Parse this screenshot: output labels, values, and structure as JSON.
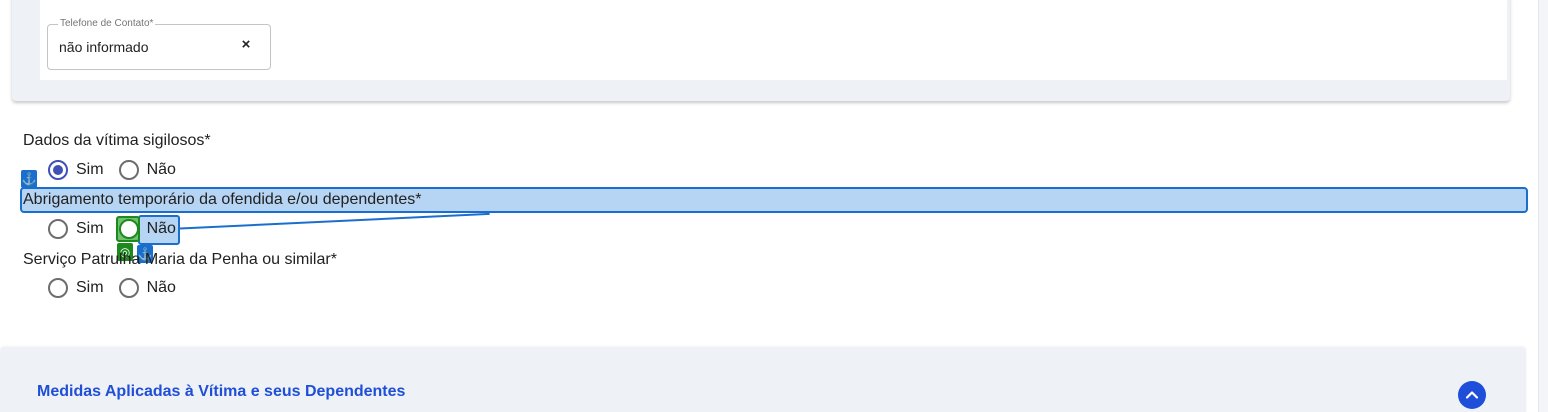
{
  "phone_field": {
    "label": "Telefone de Contato*",
    "value": "não informado",
    "clear_icon": "×"
  },
  "questions": [
    {
      "label": "Dados da vítima sigilosos*",
      "options": [
        "Sim",
        "Não"
      ],
      "selected": "Sim"
    },
    {
      "label": "Abrigamento temporário da ofendida e/ou dependentes*",
      "options": [
        "Sim",
        "Não"
      ],
      "selected": null
    },
    {
      "label": "Serviço Patrulha Maria da Penha ou similar*",
      "options": [
        "Sim",
        "Não"
      ],
      "selected": null
    }
  ],
  "accordion": {
    "title": "Medidas Aplicadas à Vítima e seus Dependentes",
    "toggle_icon": "chevron-up-icon"
  },
  "overlay": {
    "anchor_icon": "⚓",
    "target_icon": "◎"
  },
  "colors": {
    "accent": "#3f51b5",
    "link_blue": "#1f4ed8",
    "highlight_fill": "#b6d4f3",
    "highlight_border": "#1a6fce",
    "target_green": "#1e8a1e",
    "card_bg": "#eef2f6"
  }
}
